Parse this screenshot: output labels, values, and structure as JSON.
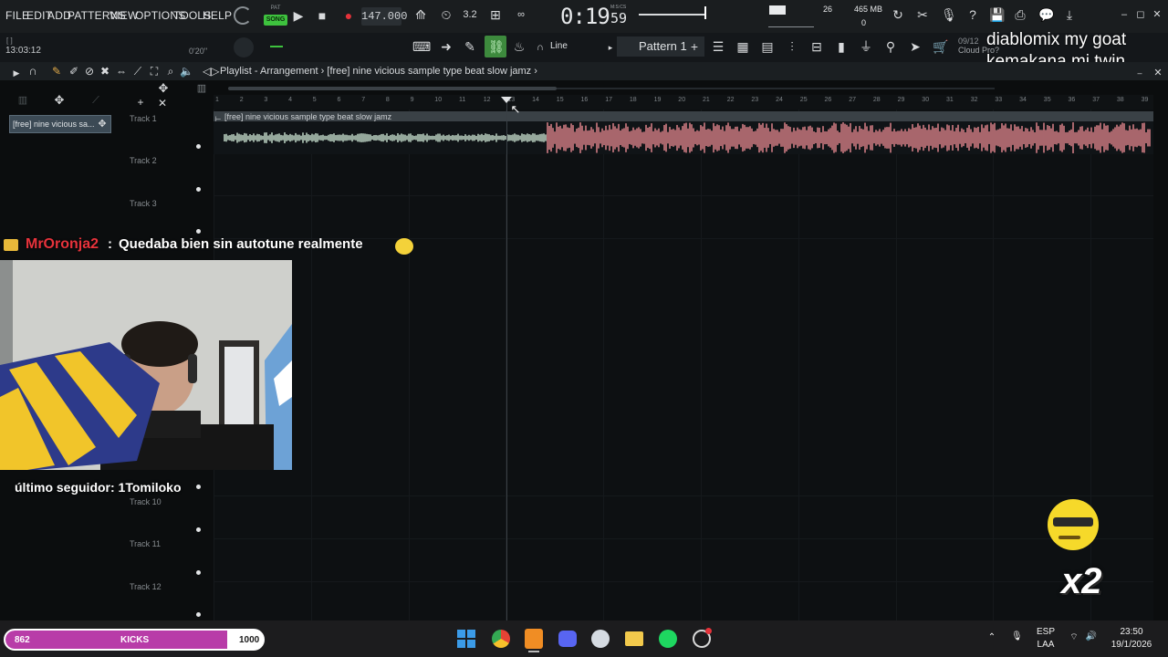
{
  "menu": [
    "FILE",
    "EDIT",
    "ADD",
    "PATTERNS",
    "VIEW",
    "OPTIONS",
    "TOOLS",
    "HELP"
  ],
  "transport": {
    "pat_label": "PAT",
    "song_label": "SONG",
    "bpm": "147.000",
    "time_main": "0:19",
    "time_sub": "59",
    "time_unit": "M:S:CS",
    "cpu": "26",
    "memory": "465 MB",
    "memory_sub": "0"
  },
  "toolbar2": {
    "clock": "13:03:12",
    "bracket": "[ ]",
    "position": "0'20''",
    "snap": "Line",
    "pattern": "Pattern 1",
    "date": "09/12",
    "cloud": "Cloud Pro?"
  },
  "overlay_text": {
    "line1": "diablomix my goat",
    "line2": "kemakana mi twin"
  },
  "playlist": {
    "header": "Playlist - Arrangement",
    "sep": "›",
    "clip_name": "[free] nine vicious sample type beat slow jamz",
    "pattern_picker": "[free] nine vicious sa...",
    "ruler": [
      "1",
      "2",
      "3",
      "4",
      "5",
      "6",
      "7",
      "8",
      "9",
      "10",
      "11",
      "12",
      "13",
      "14",
      "15",
      "16",
      "17",
      "18",
      "19",
      "20",
      "21",
      "22",
      "23",
      "24",
      "25",
      "26",
      "27",
      "28",
      "29",
      "30",
      "31",
      "32",
      "33",
      "34",
      "35",
      "36",
      "37",
      "38",
      "39"
    ],
    "tracks": [
      {
        "name": "Track 1"
      },
      {
        "name": "Track 2"
      },
      {
        "name": "Track 3"
      },
      {
        "name": "Track 10"
      },
      {
        "name": "Track 11"
      },
      {
        "name": "Track 12"
      }
    ]
  },
  "chat": {
    "user": "MrOronja2",
    "sep": ":",
    "message": "Quedaba bien sin autotune realmente"
  },
  "follower": "último seguidor: 1Tomiloko",
  "kicks": {
    "current": "862",
    "label": "KICKS",
    "goal": "1000",
    "progress": 0.862
  },
  "multiplier": "x2",
  "taskbar": {
    "lang1": "ESP",
    "lang2": "LAA",
    "time": "23:50",
    "date": "19/1/2026"
  },
  "colors": {
    "waveform_quiet": "#cfe8d6",
    "waveform_loud": "#e98a92",
    "song_green": "#3ec23e",
    "kicks_purple": "#b83ca8"
  }
}
